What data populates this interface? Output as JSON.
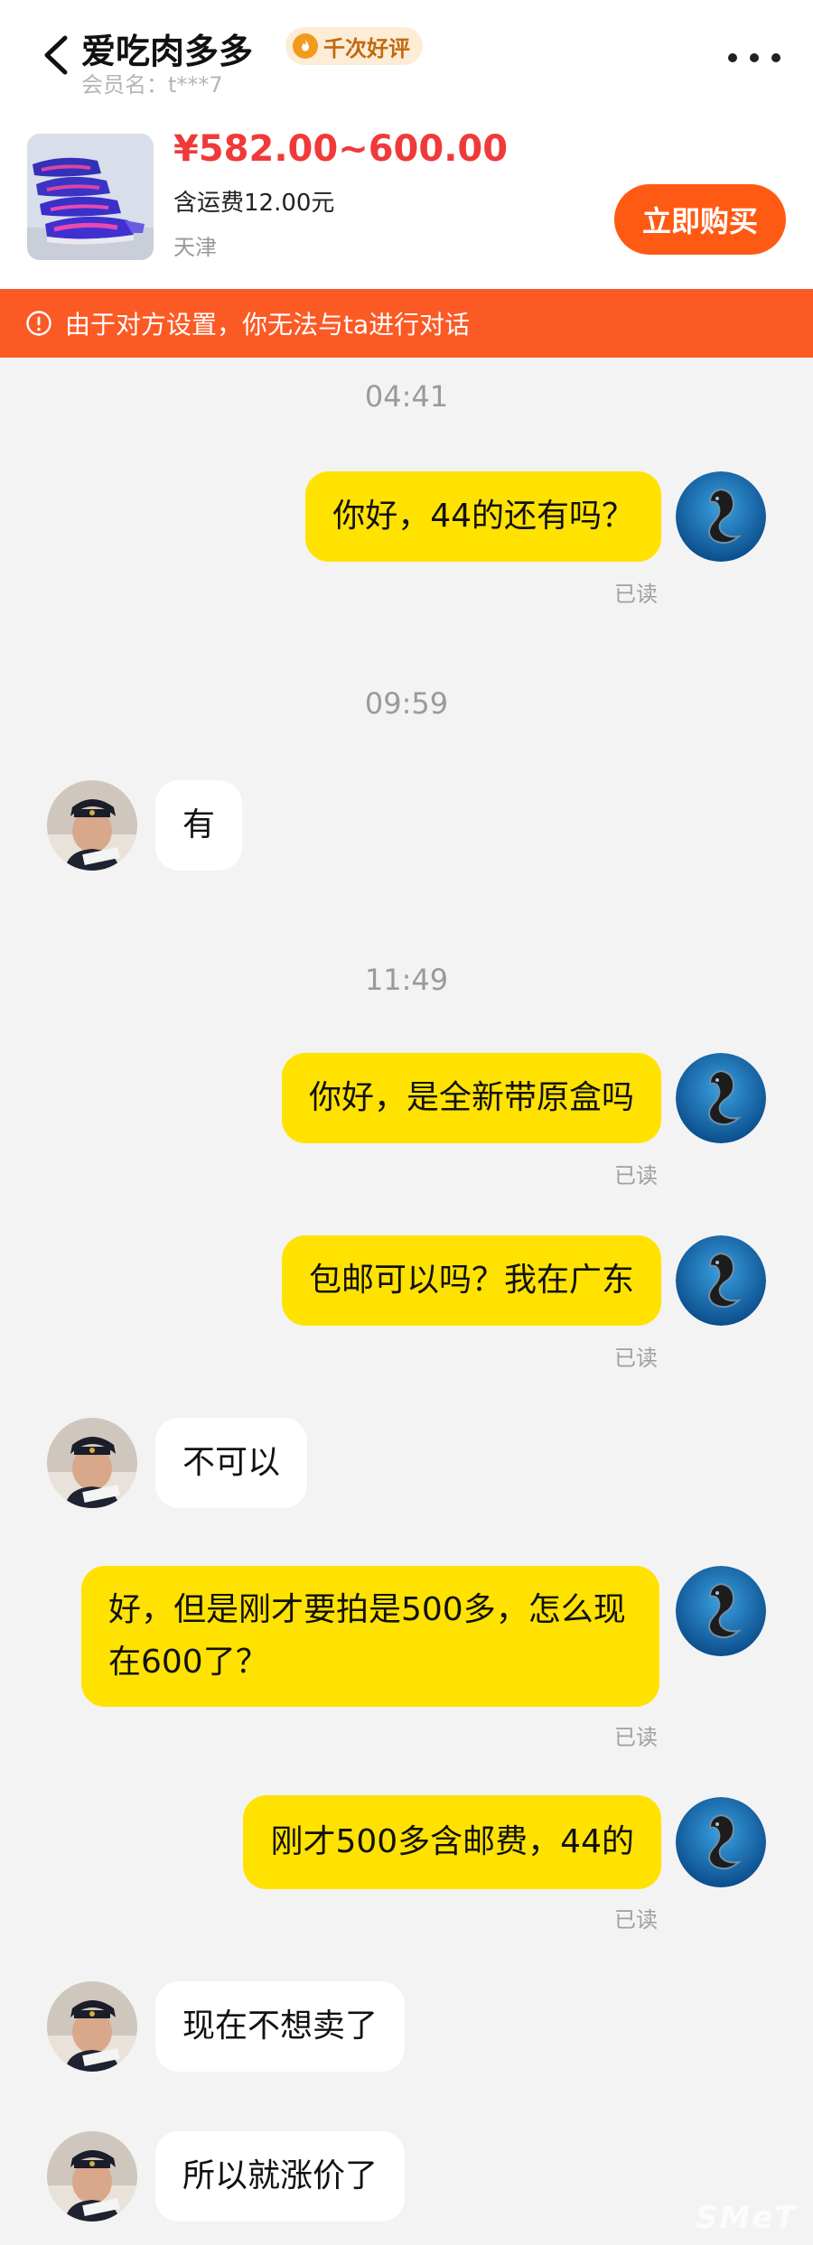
{
  "header": {
    "seller_name": "爱吃肉多多",
    "badge_label": "千次好评",
    "member_label": "会员名：t***7"
  },
  "product": {
    "price": "¥582.00~600.00",
    "shipping": "含运费12.00元",
    "location": "天津",
    "buy_label": "立即购买"
  },
  "notice": {
    "text": "由于对方设置，你无法与ta进行对话"
  },
  "messages": [
    {
      "type": "time",
      "text": "04:41"
    },
    {
      "type": "me",
      "text": "你好，44的还有吗？",
      "read": "已读"
    },
    {
      "type": "time",
      "text": "09:59"
    },
    {
      "type": "them",
      "text": "有"
    },
    {
      "type": "time",
      "text": "11:49"
    },
    {
      "type": "me",
      "text": "你好，是全新带原盒吗",
      "read": "已读"
    },
    {
      "type": "me",
      "text": "包邮可以吗？我在广东",
      "read": "已读"
    },
    {
      "type": "them",
      "text": "不可以"
    },
    {
      "type": "me",
      "text": "好，但是刚才要拍是500多，怎么现在600了？",
      "read": "已读"
    },
    {
      "type": "me",
      "text": "刚才500多含邮费，44的",
      "read": "已读"
    },
    {
      "type": "them",
      "text": "现在不想卖了"
    },
    {
      "type": "them",
      "text": "所以就涨价了"
    }
  ],
  "watermark": "SMeT",
  "colors": {
    "accent_orange": "#ff5a13",
    "notice_bg": "#fb5a25",
    "price_red": "#f03a3a",
    "my_bubble": "#ffe200",
    "their_bubble": "#ffffff"
  }
}
